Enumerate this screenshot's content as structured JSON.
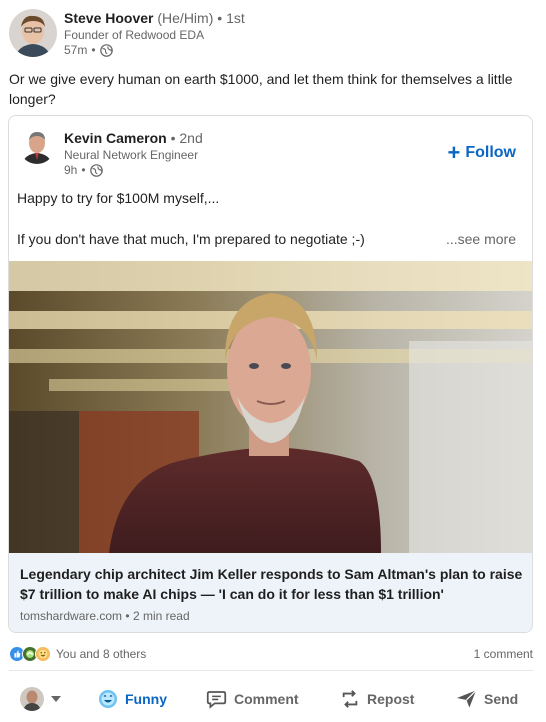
{
  "post": {
    "author_name": "Steve Hoover",
    "author_pronouns": "(He/Him)",
    "author_degree": "1st",
    "author_headline": "Founder of Redwood EDA",
    "time": "57m",
    "text": "Or we give every human on earth $1000, and let them think for themselves a little longer?"
  },
  "shared": {
    "author_name": "Kevin Cameron",
    "author_degree": "2nd",
    "author_headline": "Neural Network Engineer",
    "time": "9h",
    "follow_label": "Follow",
    "text_line1": "Happy to try for $100M myself,...",
    "text_line2": "If you don't have that much, I'm prepared to negotiate ;-)",
    "see_more": "...see more",
    "article_title": "Legendary chip architect Jim Keller responds to Sam Altman's plan to raise $7 trillion to make AI chips — 'I can do it for less than $1 trillion'",
    "article_source": "tomshardware.com",
    "article_read_time": "2 min read"
  },
  "social": {
    "reactions_text": "You and 8 others",
    "comments_text": "1 comment",
    "reaction_icons": [
      "like-icon",
      "celebrate-icon",
      "funny-icon"
    ]
  },
  "actions": {
    "funny_label": "Funny",
    "comment_label": "Comment",
    "repost_label": "Repost",
    "send_label": "Send"
  },
  "colors": {
    "accent": "#0a66c2",
    "text": "#1f1f1f",
    "secondary": "#666666",
    "article_bg": "#edf3f8"
  }
}
